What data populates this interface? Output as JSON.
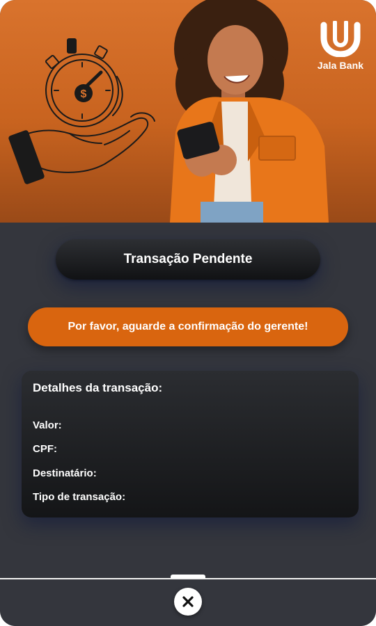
{
  "brand": {
    "name": "Jala Bank",
    "logo_icon": "jala-bank-logo"
  },
  "hero": {
    "illustration_icon": "stopwatch-coin-hand",
    "photo": "woman-using-smartphone"
  },
  "status": {
    "label": "Transação Pendente"
  },
  "alert": {
    "label": "Por favor, aguarde a confirmação do gerente!"
  },
  "details": {
    "title": "Detalhes da transação:",
    "rows": [
      {
        "label": "Valor:",
        "value": ""
      },
      {
        "label": "CPF:",
        "value": ""
      },
      {
        "label": "Destinatário:",
        "value": ""
      },
      {
        "label": "Tipo de transação:",
        "value": ""
      }
    ]
  },
  "controls": {
    "close_icon": "close-icon"
  },
  "colors": {
    "accent": "#d9650f",
    "hero_orange": "#d9732d",
    "background": "#34363d",
    "card_dark": "#141517"
  }
}
